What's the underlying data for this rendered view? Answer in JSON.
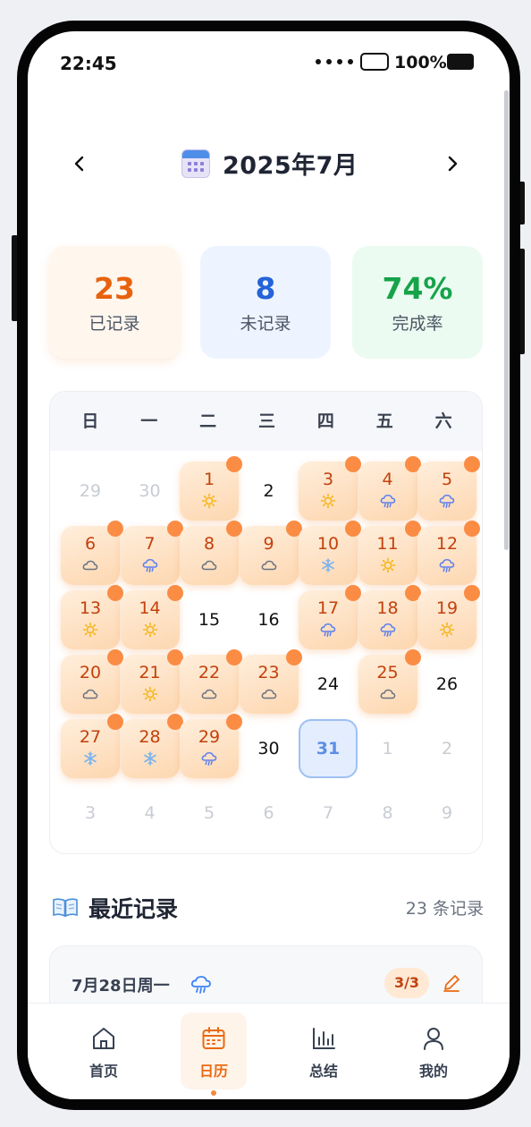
{
  "status_bar": {
    "time": "22:45",
    "battery": "100%"
  },
  "month_nav": {
    "title": "2025年7月"
  },
  "stats": [
    {
      "value": "23",
      "label": "已记录"
    },
    {
      "value": "8",
      "label": "未记录"
    },
    {
      "value": "74%",
      "label": "完成率"
    }
  ],
  "calendar": {
    "weekdays": [
      "日",
      "一",
      "二",
      "三",
      "四",
      "五",
      "六"
    ],
    "days": [
      {
        "d": "29",
        "m": 1
      },
      {
        "d": "30",
        "m": 1
      },
      {
        "d": "1",
        "r": 1,
        "w": "sun"
      },
      {
        "d": "2"
      },
      {
        "d": "3",
        "r": 1,
        "w": "sun"
      },
      {
        "d": "4",
        "r": 1,
        "w": "rain"
      },
      {
        "d": "5",
        "r": 1,
        "w": "rain"
      },
      {
        "d": "6",
        "r": 1,
        "w": "cloud"
      },
      {
        "d": "7",
        "r": 1,
        "w": "rain"
      },
      {
        "d": "8",
        "r": 1,
        "w": "cloud"
      },
      {
        "d": "9",
        "r": 1,
        "w": "cloud"
      },
      {
        "d": "10",
        "r": 1,
        "w": "snow"
      },
      {
        "d": "11",
        "r": 1,
        "w": "sun"
      },
      {
        "d": "12",
        "r": 1,
        "w": "rain"
      },
      {
        "d": "13",
        "r": 1,
        "w": "sun"
      },
      {
        "d": "14",
        "r": 1,
        "w": "sun"
      },
      {
        "d": "15"
      },
      {
        "d": "16"
      },
      {
        "d": "17",
        "r": 1,
        "w": "rain"
      },
      {
        "d": "18",
        "r": 1,
        "w": "rain"
      },
      {
        "d": "19",
        "r": 1,
        "w": "sun"
      },
      {
        "d": "20",
        "r": 1,
        "w": "cloud"
      },
      {
        "d": "21",
        "r": 1,
        "w": "sun"
      },
      {
        "d": "22",
        "r": 1,
        "w": "cloud"
      },
      {
        "d": "23",
        "r": 1,
        "w": "cloud"
      },
      {
        "d": "24"
      },
      {
        "d": "25",
        "r": 1,
        "w": "cloud"
      },
      {
        "d": "26"
      },
      {
        "d": "27",
        "r": 1,
        "w": "snow"
      },
      {
        "d": "28",
        "r": 1,
        "w": "snow"
      },
      {
        "d": "29",
        "r": 1,
        "w": "rain"
      },
      {
        "d": "30"
      },
      {
        "d": "31",
        "t": 1
      },
      {
        "d": "1",
        "m": 1
      },
      {
        "d": "2",
        "m": 1
      },
      {
        "d": "3",
        "m": 1
      },
      {
        "d": "4",
        "m": 1
      },
      {
        "d": "5",
        "m": 1
      },
      {
        "d": "6",
        "m": 1
      },
      {
        "d": "7",
        "m": 1
      },
      {
        "d": "8",
        "m": 1
      },
      {
        "d": "9",
        "m": 1
      }
    ]
  },
  "recent": {
    "title": "最近记录",
    "count": "23 条记录",
    "first_record": {
      "date": "7月28日周一",
      "weather_icon": "rain-icon",
      "progress": "3/3"
    }
  },
  "tabs": [
    {
      "label": "首页",
      "icon": "home-icon"
    },
    {
      "label": "日历",
      "icon": "calendar-icon",
      "active": true
    },
    {
      "label": "总结",
      "icon": "bar-chart-icon"
    },
    {
      "label": "我的",
      "icon": "user-icon"
    }
  ],
  "colors": {
    "accent": "#ea6a12",
    "recorded_bg": "#fdd7b0",
    "today_border": "#9ec1f3"
  }
}
